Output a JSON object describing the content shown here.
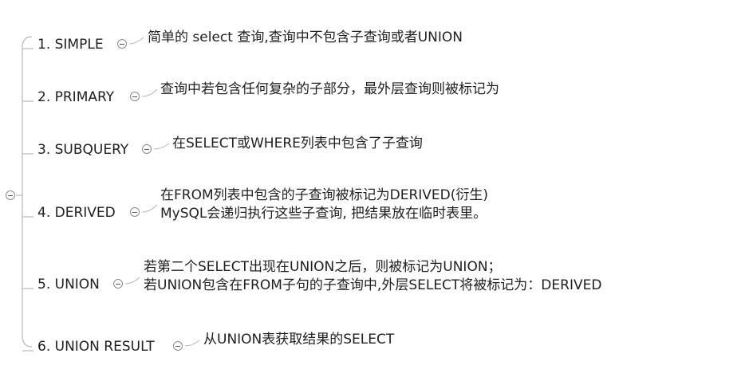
{
  "nodes": [
    {
      "label": "1. SIMPLE",
      "lines": [
        "简单的 select 查询,查询中不包含子查询或者UNION"
      ]
    },
    {
      "label": "2. PRIMARY",
      "lines": [
        "查询中若包含任何复杂的子部分，最外层查询则被标记为"
      ]
    },
    {
      "label": "3. SUBQUERY",
      "lines": [
        "在SELECT或WHERE列表中包含了子查询"
      ]
    },
    {
      "label": "4. DERIVED",
      "lines": [
        "在FROM列表中包含的子查询被标记为DERIVED(衍生)",
        "MySQL会递归执行这些子查询, 把结果放在临时表里。"
      ]
    },
    {
      "label": "5. UNION",
      "lines": [
        "若第二个SELECT出现在UNION之后，则被标记为UNION；",
        "若UNION包含在FROM子句的子查询中,外层SELECT将被标记为：DERIVED"
      ]
    },
    {
      "label": "6. UNION RESULT",
      "lines": [
        "从UNION表获取结果的SELECT"
      ]
    }
  ],
  "colors": {
    "line": "#b8b8b8",
    "text": "#202020"
  }
}
